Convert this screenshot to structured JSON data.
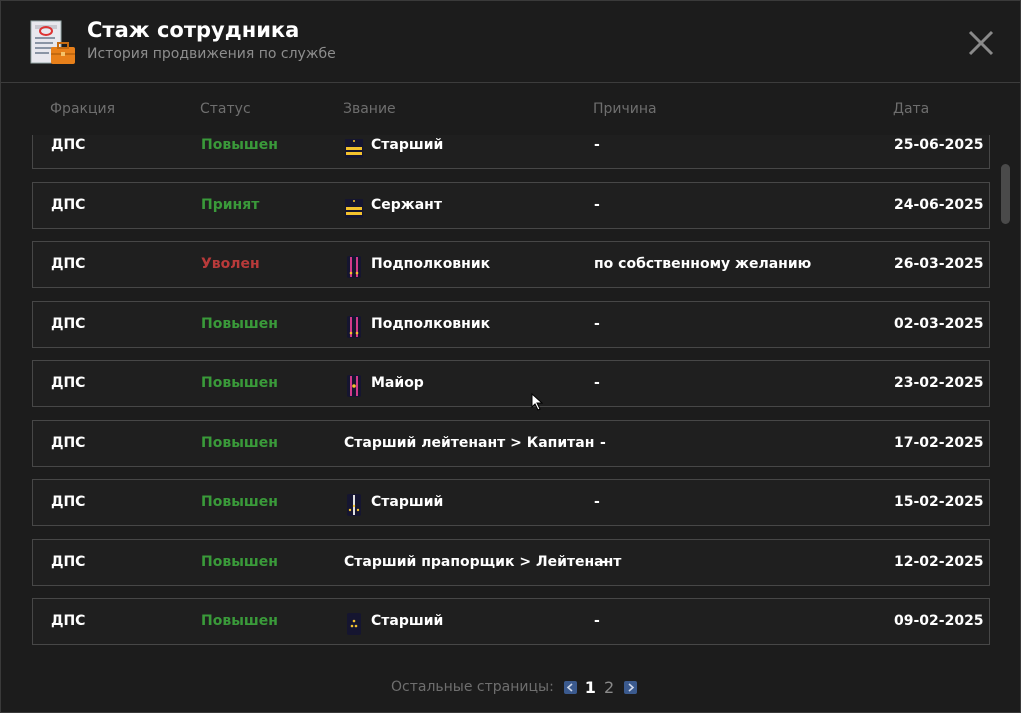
{
  "header": {
    "title": "Стаж сотрудника",
    "subtitle": "История продвижения по службе"
  },
  "columns": {
    "faction": "Фракция",
    "status": "Статус",
    "rank": "Звание",
    "reason": "Причина",
    "date": "Дата"
  },
  "rows": [
    {
      "faction": "ДПС",
      "status": "Повышен",
      "status_color": "#3a9a3a",
      "rank_icon": "sergeant-stripes-icon",
      "rank": "Старший",
      "reason": "-",
      "date": "25-06-2025"
    },
    {
      "faction": "ДПС",
      "status": "Принят",
      "status_color": "#3a9a3a",
      "rank_icon": "sergeant-stripes-icon",
      "rank": "Сержант",
      "reason": "-",
      "date": "24-06-2025"
    },
    {
      "faction": "ДПС",
      "status": "Уволен",
      "status_color": "#b83a3a",
      "rank_icon": "lieutenant-colonel-epaulet-icon",
      "rank": "Подполковник",
      "reason": "по собственному желанию",
      "date": "26-03-2025"
    },
    {
      "faction": "ДПС",
      "status": "Повышен",
      "status_color": "#3a9a3a",
      "rank_icon": "lieutenant-colonel-epaulet-icon",
      "rank": "Подполковник",
      "reason": "-",
      "date": "02-03-2025"
    },
    {
      "faction": "ДПС",
      "status": "Повышен",
      "status_color": "#3a9a3a",
      "rank_icon": "major-epaulet-icon",
      "rank": "Майор",
      "reason": "-",
      "date": "23-02-2025"
    },
    {
      "faction": "ДПС",
      "status": "Повышен",
      "status_color": "#3a9a3a",
      "rank_icon": "",
      "rank": "Старший лейтенант > Капитан",
      "reason": "-",
      "date": "17-02-2025"
    },
    {
      "faction": "ДПС",
      "status": "Повышен",
      "status_color": "#3a9a3a",
      "rank_icon": "senior-lieutenant-epaulet-icon",
      "rank": "Старший",
      "reason": "-",
      "date": "15-02-2025"
    },
    {
      "faction": "ДПС",
      "status": "Повышен",
      "status_color": "#3a9a3a",
      "rank_icon": "",
      "rank": "Старший прапорщик > Лейтенант",
      "reason": "-",
      "date": "12-02-2025"
    },
    {
      "faction": "ДПС",
      "status": "Повышен",
      "status_color": "#3a9a3a",
      "rank_icon": "senior-warrant-epaulet-icon",
      "rank": "Старший",
      "reason": "-",
      "date": "09-02-2025"
    }
  ],
  "pagination": {
    "label": "Остальные страницы:",
    "pages": [
      "1",
      "2"
    ],
    "current": "1"
  }
}
